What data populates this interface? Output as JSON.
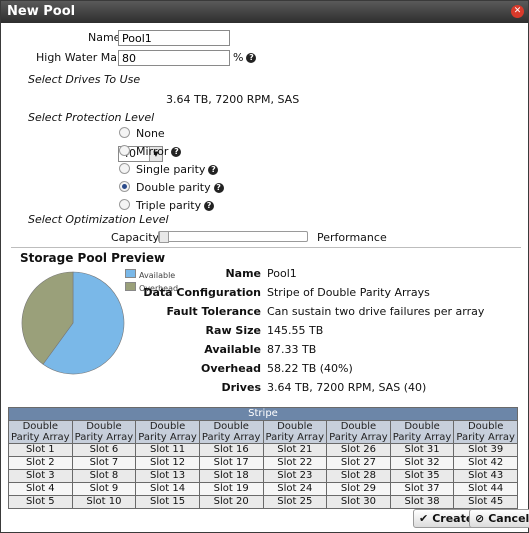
{
  "dialog": {
    "title": "New Pool"
  },
  "form": {
    "name_label": "Name",
    "name_value": "Pool1",
    "hwm_label": "High Water Mark",
    "hwm_value": "80",
    "hwm_unit": "%"
  },
  "drives": {
    "section": "Select Drives To Use",
    "count": "40",
    "description": "3.64 TB, 7200 RPM, SAS"
  },
  "protection": {
    "section": "Select Protection Level",
    "options": [
      {
        "label": "None",
        "selected": false,
        "help": false
      },
      {
        "label": "Mirror",
        "selected": false,
        "help": true
      },
      {
        "label": "Single parity",
        "selected": false,
        "help": true
      },
      {
        "label": "Double parity",
        "selected": true,
        "help": true
      },
      {
        "label": "Triple parity",
        "selected": false,
        "help": true
      }
    ]
  },
  "optimization": {
    "section": "Select Optimization Level",
    "left_label": "Capacity",
    "right_label": "Performance",
    "level": 0
  },
  "preview": {
    "title": "Storage Pool Preview",
    "legend": [
      {
        "label": "Available",
        "color": "#7ab8e8"
      },
      {
        "label": "Overhead",
        "color": "#9aa07a"
      }
    ],
    "pie": {
      "available_fraction": 0.6,
      "overhead_fraction": 0.4
    },
    "details": [
      {
        "key": "Name",
        "value": "Pool1"
      },
      {
        "key": "Data Configuration",
        "value": "Stripe of Double Parity Arrays"
      },
      {
        "key": "Fault Tolerance",
        "value": "Can sustain two drive failures per array"
      },
      {
        "key": "Raw Size",
        "value": "145.55 TB"
      },
      {
        "key": "Available",
        "value": "87.33 TB"
      },
      {
        "key": "Overhead",
        "value": "58.22 TB (40%)"
      },
      {
        "key": "Drives",
        "value": "3.64 TB, 7200 RPM, SAS (40)"
      }
    ]
  },
  "stripe": {
    "title": "Stripe",
    "column_header": "Double Parity Array",
    "columns": [
      [
        "Slot 1",
        "Slot 2",
        "Slot 3",
        "Slot 4",
        "Slot 5"
      ],
      [
        "Slot 6",
        "Slot 7",
        "Slot 8",
        "Slot 9",
        "Slot 10"
      ],
      [
        "Slot 11",
        "Slot 12",
        "Slot 13",
        "Slot 14",
        "Slot 15"
      ],
      [
        "Slot 16",
        "Slot 17",
        "Slot 18",
        "Slot 19",
        "Slot 20"
      ],
      [
        "Slot 21",
        "Slot 22",
        "Slot 23",
        "Slot 24",
        "Slot 25"
      ],
      [
        "Slot 26",
        "Slot 27",
        "Slot 28",
        "Slot 29",
        "Slot 30"
      ],
      [
        "Slot 31",
        "Slot 32",
        "Slot 35",
        "Slot 37",
        "Slot 38"
      ],
      [
        "Slot 39",
        "Slot 42",
        "Slot 43",
        "Slot 44",
        "Slot 45"
      ]
    ]
  },
  "buttons": {
    "create": "Create",
    "cancel": "Cancel"
  }
}
